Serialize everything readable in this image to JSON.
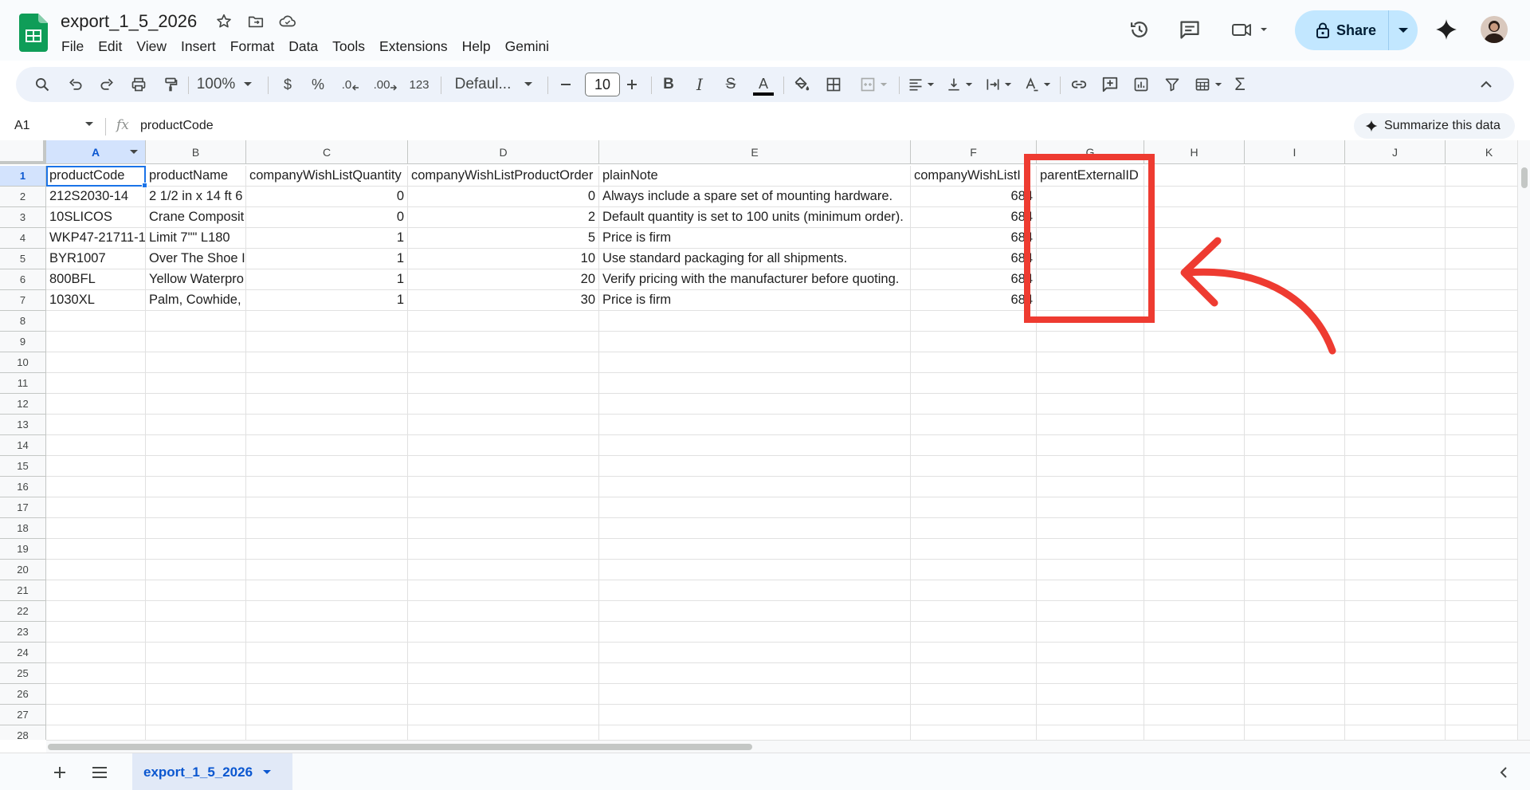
{
  "app": {
    "doc_title": "export_1_5_2026",
    "menu": [
      "File",
      "Edit",
      "View",
      "Insert",
      "Format",
      "Data",
      "Tools",
      "Extensions",
      "Help",
      "Gemini"
    ],
    "share_label": "Share"
  },
  "toolbar": {
    "zoom": "100%",
    "currency": "$",
    "percent": "%",
    "dec_decrease": ".0",
    "dec_increase": ".00",
    "number_format": "123",
    "font": "Defaul...",
    "font_size": "10",
    "bold": "B",
    "italic": "I",
    "strike": "S",
    "text_color_letter": "A",
    "sum": "Σ"
  },
  "formula_bar": {
    "name_box": "A1",
    "fx": "fx",
    "value": "productCode",
    "summarize_label": "Summarize this data"
  },
  "grid": {
    "columns": [
      "A",
      "B",
      "C",
      "D",
      "E",
      "F",
      "G",
      "H",
      "I",
      "J",
      "K"
    ],
    "rows": [
      [
        "productCode",
        "productName",
        "companyWishListQuantity",
        "companyWishListProductOrder",
        "plainNote",
        "companyWishListI",
        "parentExternalID"
      ],
      [
        "212S2030-14",
        "2 1/2 in x 14 ft 6",
        "0",
        "0",
        "Always include a spare set of mounting hardware.",
        "684"
      ],
      [
        "10SLICOS",
        "Crane Composit",
        "0",
        "2",
        "Default quantity is set to 100 units (minimum order).",
        "684"
      ],
      [
        "WKP47-21711-1",
        "Limit 7\"\" L180",
        "1",
        "5",
        "Price is firm",
        "684"
      ],
      [
        "BYR1007",
        "Over The Shoe I",
        "1",
        "10",
        "Use standard packaging for all shipments.",
        "684"
      ],
      [
        "800BFL",
        "Yellow Waterpro",
        "1",
        "20",
        "Verify pricing with the manufacturer before quoting.",
        "684"
      ],
      [
        "1030XL",
        "Palm, Cowhide,",
        "1",
        "30",
        "Price is firm",
        "684"
      ]
    ],
    "visible_row_count": 28
  },
  "sheets": {
    "active": "export_1_5_2026"
  },
  "colors": {
    "accent": "#0b57d0",
    "share_bg": "#c2e7ff",
    "annotation": "#ee3b31",
    "selection": "#1a73e8"
  }
}
